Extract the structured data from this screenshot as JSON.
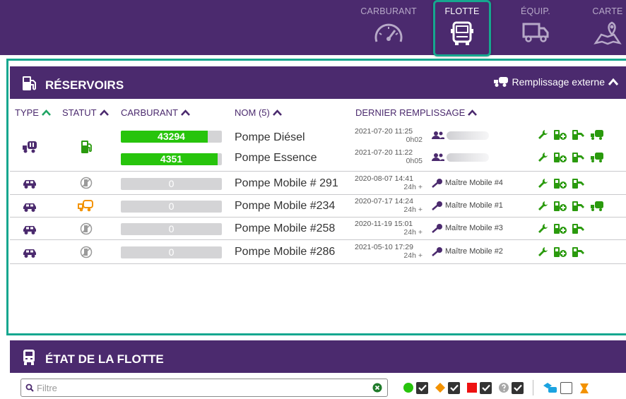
{
  "colors": {
    "brand": "#4b2a6e",
    "accent": "#16a78f",
    "ok": "#27c40c",
    "action": "#2a9a0d",
    "warn": "#f39200",
    "danger": "#ee1111"
  },
  "nav": {
    "tabs": [
      {
        "label": "CARBURANT",
        "icon": "gauge-icon",
        "active": false
      },
      {
        "label": "FLOTTE",
        "icon": "vehicle-front-icon",
        "active": true
      },
      {
        "label": "ÉQUIP.",
        "icon": "truck-icon",
        "active": false
      },
      {
        "label": "CARTE",
        "icon": "map-pin-icon",
        "active": false
      }
    ]
  },
  "reservoirs": {
    "title": "RÉSERVOIRS",
    "external_label": "Remplissage externe",
    "columns": {
      "type": "TYPE",
      "statut": "STATUT",
      "carburant": "CARBURANT",
      "nom": "NOM (5)",
      "dernier": "DERNIER REMPLISSAGE"
    },
    "rows": [
      {
        "type_icon": "tank-truck-icon",
        "status_icon": "fuel-pump-icon",
        "tanks": [
          {
            "value": "43294",
            "level": 0.86,
            "nom": "Pompe Diésel",
            "date": "2021-07-20 11:25",
            "duration": "0h02",
            "user_icon": "users-icon"
          },
          {
            "value": "4351",
            "level": 0.96,
            "nom": "Pompe Essence",
            "date": "2021-07-20 11:22",
            "duration": "0h05",
            "user_icon": "users-icon"
          }
        ]
      },
      {
        "type_icon": "car-icon",
        "status_icon": "pump-off-icon",
        "value": "0",
        "level": 0,
        "nom": "Pompe Mobile # 291",
        "date": "2020-08-07 14:41",
        "duration": "24h +",
        "key_label": "Maître Mobile #4"
      },
      {
        "type_icon": "car-icon",
        "status_icon": "tank-warning-icon",
        "value": "0",
        "level": 0,
        "nom": "Pompe Mobile #234",
        "date": "2020-07-17 14:24",
        "duration": "24h +",
        "key_label": "Maître Mobile #1"
      },
      {
        "type_icon": "car-icon",
        "status_icon": "pump-off-icon",
        "value": "0",
        "level": 0,
        "nom": "Pompe Mobile #258",
        "date": "2020-11-19 15:01",
        "duration": "24h +",
        "key_label": "Maître Mobile #3"
      },
      {
        "type_icon": "car-icon",
        "status_icon": "pump-off-icon",
        "value": "0",
        "level": 0,
        "nom": "Pompe Mobile #286",
        "date": "2021-05-10 17:29",
        "duration": "24h +",
        "key_label": "Maître Mobile #2"
      }
    ]
  },
  "flotte": {
    "title": "ÉTAT DE LA FLOTTE",
    "filter_placeholder": "Filtre"
  }
}
